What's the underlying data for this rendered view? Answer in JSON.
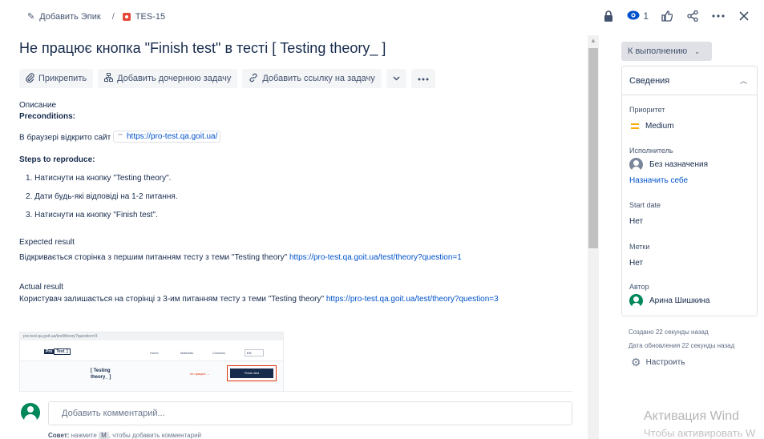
{
  "breadcrumb": {
    "add_epic": "Добавить Эпик",
    "separator": "/",
    "issue_key": "TES-15"
  },
  "top_actions": {
    "watchers_count": "1",
    "icons": [
      "lock-icon",
      "eye-icon",
      "thumbs-up-icon",
      "share-icon",
      "more-icon",
      "close-icon"
    ]
  },
  "issue": {
    "title": "Не працює кнопка \"Finish test\" в тесті [ Testing theory_ ]"
  },
  "buttons": {
    "attach": "Прикрепить",
    "add_child": "Добавить дочернюю задачу",
    "add_link": "Добавить ссылку на задачу"
  },
  "description": {
    "label": "Описание",
    "preconditions_heading": "Preconditions:",
    "precondition_text": "В браузері відкрито сайт",
    "precondition_link": "https://pro-test.qa.goit.ua/",
    "steps_heading": "Steps to reproduce:",
    "steps": [
      "1. Натиснути на кнопку \"Testing theory\".",
      "2. Дати будь-які відповіді на 1-2 питання.",
      "3. Натиснути на кнопку \"Finish test\"."
    ],
    "expected_label": "Expected result",
    "expected_text": "Відкривається сторінка з першим питанням тесту з теми \"Testing theory\"",
    "expected_link": "https://pro-test.qa.goit.ua/test/theory?question=1",
    "actual_label": "Actual result",
    "actual_text": "Користувач залишається на сторінці з 3-им питанням тесту з теми \"Testing theory\"",
    "actual_link": "https://pro-test.qa.goit.ua/test/theory?question=3"
  },
  "attachment": {
    "url": "pro-test.qa.goit.ua/test/theory?question=3",
    "logo_dark": "Pro",
    "logo_light": "Test_]",
    "menu": [
      "Home",
      "Materials",
      "Contacts"
    ],
    "lang": "EN",
    "heading_line1": "[ Testing",
    "heading_line2": "theory_ ]",
    "arrow_note": "не працює",
    "button_text": "Finish test"
  },
  "comment": {
    "placeholder": "Добавить комментарий...",
    "tip_bold": "Совет:",
    "tip_pre": "нажмите",
    "tip_key": "M",
    "tip_post": ", чтобы добавить комментарий"
  },
  "sidebar": {
    "status": "К выполнению",
    "details_title": "Сведения",
    "priority_label": "Приоритет",
    "priority_value": "Medium",
    "assignee_label": "Исполнитель",
    "assignee_value": "Без назначения",
    "assign_me": "Назначить себе",
    "start_date_label": "Start date",
    "start_date_value": "Нет",
    "labels_label": "Метки",
    "labels_value": "Нет",
    "reporter_label": "Автор",
    "reporter_value": "Арина Шишкина",
    "created": "Создано 22 секунды назад",
    "updated": "Дата обновления 22 секунды назад",
    "settings": "Настроить"
  },
  "watermark": {
    "line1": "Активация Wind",
    "line2": "Чтобы активировать W"
  },
  "colors": {
    "link": "#0052cc",
    "accent_green": "#00875a",
    "priority_medium": "#ffab00",
    "bug_red": "#e5493a"
  }
}
